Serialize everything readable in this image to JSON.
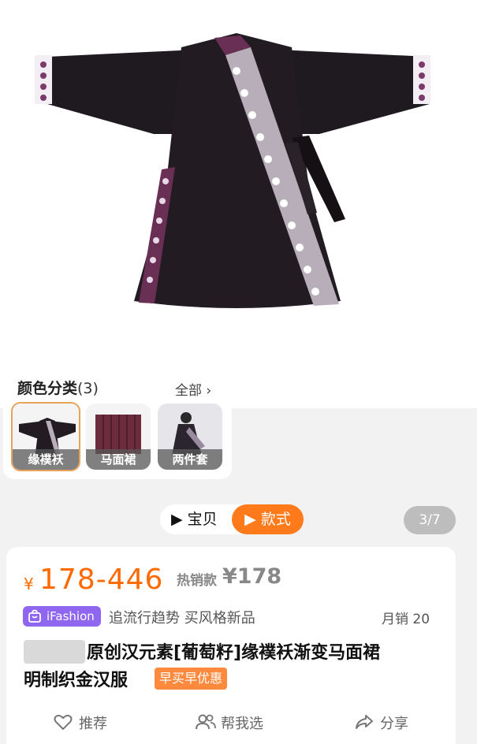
{
  "colors": {
    "accent": "#ff7a1a",
    "price": "#ff6a00",
    "selected_border": "#e8a25a",
    "badge": "#8f66f0",
    "promo": "#ff8a3d"
  },
  "color_section": {
    "title": "颜色分类",
    "count": "(3)",
    "all_label": "全部 ›",
    "swatches": [
      {
        "label": "缘襆袄",
        "selected": true
      },
      {
        "label": "马面裙",
        "selected": false
      },
      {
        "label": "两件套",
        "selected": false
      }
    ]
  },
  "view_toggle": {
    "left_label": "▶ 宝贝",
    "right_label": "▶ 款式"
  },
  "image_counter": "3/7",
  "product": {
    "currency": "¥",
    "price_range": "178-446",
    "hot_label": "热销款",
    "hot_price": "¥178",
    "badge": "iFashion",
    "slogan": "追流行趋势 买风格新品",
    "monthly_sales": "月销  20",
    "title_line1": "原创汉元素[葡萄籽]缘襆袄渐变马面裙",
    "title_line2": "明制织金汉服",
    "promo_tag": "早买早优惠"
  },
  "actions": [
    {
      "label": "推荐",
      "icon": "heart-icon"
    },
    {
      "label": "帮我选",
      "icon": "people-icon"
    },
    {
      "label": "分享",
      "icon": "share-icon"
    }
  ]
}
